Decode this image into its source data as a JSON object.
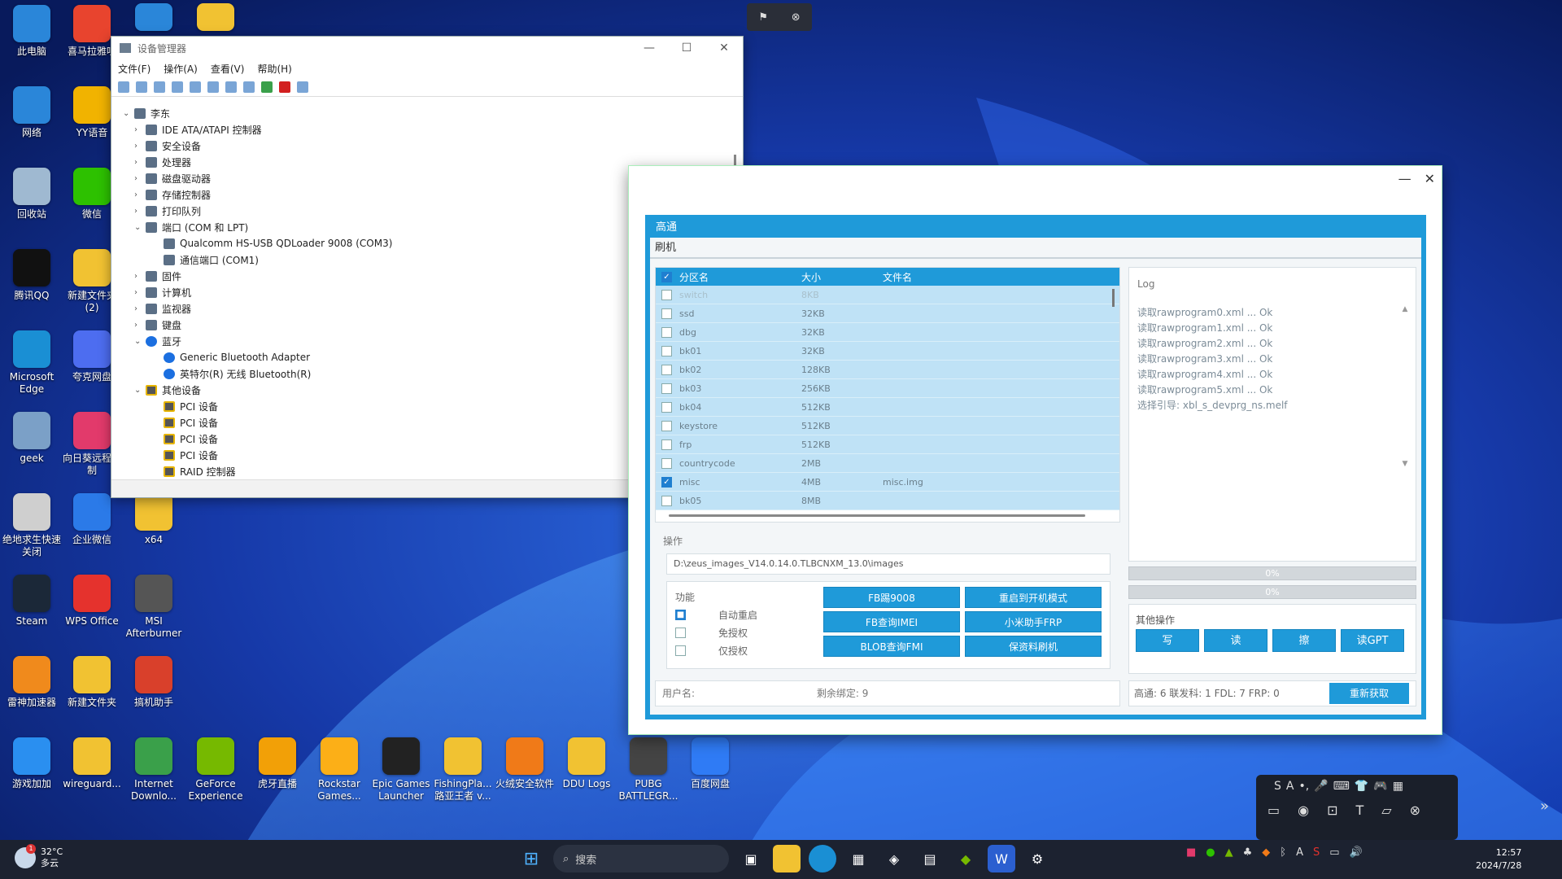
{
  "desktop": {
    "icons": [
      {
        "label": "此电脑",
        "color": "#2a86d9"
      },
      {
        "label": "喜马拉雅听",
        "color": "#e8442e"
      },
      {
        "label": "网络",
        "color": "#2a86d9"
      },
      {
        "label": "YY语音",
        "color": "#f1b300"
      },
      {
        "label": "回收站",
        "color": "#9fb9d1"
      },
      {
        "label": "微信",
        "color": "#2dc100"
      },
      {
        "label": "腾讯QQ",
        "color": "#111111"
      },
      {
        "label": "新建文件夹 (2)",
        "color": "#f1c232"
      },
      {
        "label": "Microsoft Edge",
        "color": "#1a8fd4"
      },
      {
        "label": "夸克网盘",
        "color": "#4d6df0"
      },
      {
        "label": "geek",
        "color": "#7ba0c7"
      },
      {
        "label": "向日葵远程控制",
        "color": "#e23a6b"
      },
      {
        "label": "绝地求生快速关闭",
        "color": "#cfcfcf"
      },
      {
        "label": "企业微信",
        "color": "#2b7ae8"
      },
      {
        "label": "x64",
        "color": "#f1c232"
      },
      {
        "label": "Steam",
        "color": "#1b2838"
      },
      {
        "label": "WPS Office",
        "color": "#e5322d"
      },
      {
        "label": "MSI Afterburner",
        "color": "#555555"
      },
      {
        "label": "雷神加速器",
        "color": "#f08a1c"
      },
      {
        "label": "新建文件夹",
        "color": "#f1c232"
      },
      {
        "label": "搞机助手",
        "color": "#d9402b"
      },
      {
        "label": "游戏加加",
        "color": "#2a8ff0"
      },
      {
        "label": "wireguard...",
        "color": "#f1c232"
      },
      {
        "label": "Internet Downlo...",
        "color": "#3aa04a"
      },
      {
        "label": "GeForce Experience",
        "color": "#76b900"
      },
      {
        "label": "虎牙直播",
        "color": "#f2a007"
      },
      {
        "label": "Rockstar Games...",
        "color": "#fcaf17"
      },
      {
        "label": "Epic Games Launcher",
        "color": "#222222"
      },
      {
        "label": "FishingPla... 路亚王者 v...",
        "color": "#f1c232"
      },
      {
        "label": "火绒安全软件",
        "color": "#f07a18"
      },
      {
        "label": "DDU Logs",
        "color": "#f1c232"
      },
      {
        "label": "PUBG BATTLEGR...",
        "color": "#444444"
      },
      {
        "label": "百度网盘",
        "color": "#2f7bf5"
      }
    ],
    "top_icons": [
      "#2a86d9",
      "#f1c232"
    ]
  },
  "devmgr": {
    "title": "设备管理器",
    "menu": [
      "文件(F)",
      "操作(A)",
      "查看(V)",
      "帮助(H)"
    ],
    "tree": [
      {
        "text": "李东",
        "level": 0,
        "expander": "v"
      },
      {
        "text": "IDE ATA/ATAPI 控制器",
        "level": 1,
        "expander": ">"
      },
      {
        "text": "安全设备",
        "level": 1,
        "expander": ">"
      },
      {
        "text": "处理器",
        "level": 1,
        "expander": ">"
      },
      {
        "text": "磁盘驱动器",
        "level": 1,
        "expander": ">"
      },
      {
        "text": "存储控制器",
        "level": 1,
        "expander": ">"
      },
      {
        "text": "打印队列",
        "level": 1,
        "expander": ">"
      },
      {
        "text": "端口 (COM 和 LPT)",
        "level": 1,
        "expander": "v"
      },
      {
        "text": "Qualcomm HS-USB QDLoader 9008 (COM3)",
        "level": 2,
        "expander": ""
      },
      {
        "text": "通信端口 (COM1)",
        "level": 2,
        "expander": ""
      },
      {
        "text": "固件",
        "level": 1,
        "expander": ">"
      },
      {
        "text": "计算机",
        "level": 1,
        "expander": ">"
      },
      {
        "text": "监视器",
        "level": 1,
        "expander": ">"
      },
      {
        "text": "键盘",
        "level": 1,
        "expander": ">"
      },
      {
        "text": "蓝牙",
        "level": 1,
        "expander": "v",
        "icon": "bt"
      },
      {
        "text": "Generic Bluetooth Adapter",
        "level": 2,
        "expander": "",
        "icon": "bt"
      },
      {
        "text": "英特尔(R) 无线 Bluetooth(R)",
        "level": 2,
        "expander": "",
        "icon": "bt"
      },
      {
        "text": "其他设备",
        "level": 1,
        "expander": "v",
        "icon": "warn"
      },
      {
        "text": "PCI 设备",
        "level": 2,
        "expander": "",
        "icon": "warn"
      },
      {
        "text": "PCI 设备",
        "level": 2,
        "expander": "",
        "icon": "warn"
      },
      {
        "text": "PCI 设备",
        "level": 2,
        "expander": "",
        "icon": "warn"
      },
      {
        "text": "PCI 设备",
        "level": 2,
        "expander": "",
        "icon": "warn"
      },
      {
        "text": "RAID 控制器",
        "level": 2,
        "expander": "",
        "icon": "warn"
      }
    ]
  },
  "tool": {
    "header": "高通",
    "tab": "刷机",
    "columns": [
      "分区名",
      "大小",
      "文件名"
    ],
    "partitions": [
      {
        "name": "switch",
        "size": "8KB",
        "file": "",
        "checked": false,
        "dim": true
      },
      {
        "name": "ssd",
        "size": "32KB",
        "file": "",
        "checked": false
      },
      {
        "name": "dbg",
        "size": "32KB",
        "file": "",
        "checked": false
      },
      {
        "name": "bk01",
        "size": "32KB",
        "file": "",
        "checked": false
      },
      {
        "name": "bk02",
        "size": "128KB",
        "file": "",
        "checked": false
      },
      {
        "name": "bk03",
        "size": "256KB",
        "file": "",
        "checked": false
      },
      {
        "name": "bk04",
        "size": "512KB",
        "file": "",
        "checked": false
      },
      {
        "name": "keystore",
        "size": "512KB",
        "file": "",
        "checked": false
      },
      {
        "name": "frp",
        "size": "512KB",
        "file": "",
        "checked": false
      },
      {
        "name": "countrycode",
        "size": "2MB",
        "file": "",
        "checked": false
      },
      {
        "name": "misc",
        "size": "4MB",
        "file": "misc.img",
        "checked": true
      },
      {
        "name": "bk05",
        "size": "8MB",
        "file": "",
        "checked": false
      }
    ],
    "log_title": "Log",
    "log_lines": [
      "读取rawprogram0.xml ... Ok",
      "读取rawprogram1.xml ... Ok",
      "读取rawprogram2.xml ... Ok",
      "读取rawprogram3.xml ... Ok",
      "读取rawprogram4.xml ... Ok",
      "读取rawprogram5.xml ... Ok",
      "选择引导: xbl_s_devprg_ns.melf"
    ],
    "ops_title": "操作",
    "path": "D:\\zeus_images_V14.0.14.0.TLBCNXM_13.0\\images",
    "func_title": "功能",
    "options": [
      {
        "label": "自动重启",
        "checked": true
      },
      {
        "label": "免授权",
        "checked": false
      },
      {
        "label": "仅授权",
        "checked": false
      }
    ],
    "buttons": [
      "FB踢9008",
      "重启到开机模式",
      "FB查询IMEI",
      "小米助手FRP",
      "BLOB查询FMI",
      "保资料刷机"
    ],
    "progress": [
      {
        "text": "0%",
        "value": 0
      },
      {
        "text": "0%",
        "value": 0
      }
    ],
    "other_title": "其他操作",
    "other_buttons": [
      "写",
      "读",
      "擦",
      "读GPT"
    ],
    "user_label": "用户名:",
    "remaining": "剩余绑定: 9",
    "counts": "高通: 6 联发科: 1 FDL: 7 FRP: 0",
    "refresh": "重新获取"
  },
  "ime": {
    "buttons": [
      "S",
      "A",
      "•,",
      "🎤",
      "⌨",
      "👕",
      "🎮",
      "▦"
    ]
  },
  "taskbar": {
    "temp": "32°C",
    "weather": "多云",
    "badge": "1",
    "search": "搜索",
    "time": "12:57",
    "date": "2024/7/28",
    "tray": [
      "A"
    ]
  }
}
